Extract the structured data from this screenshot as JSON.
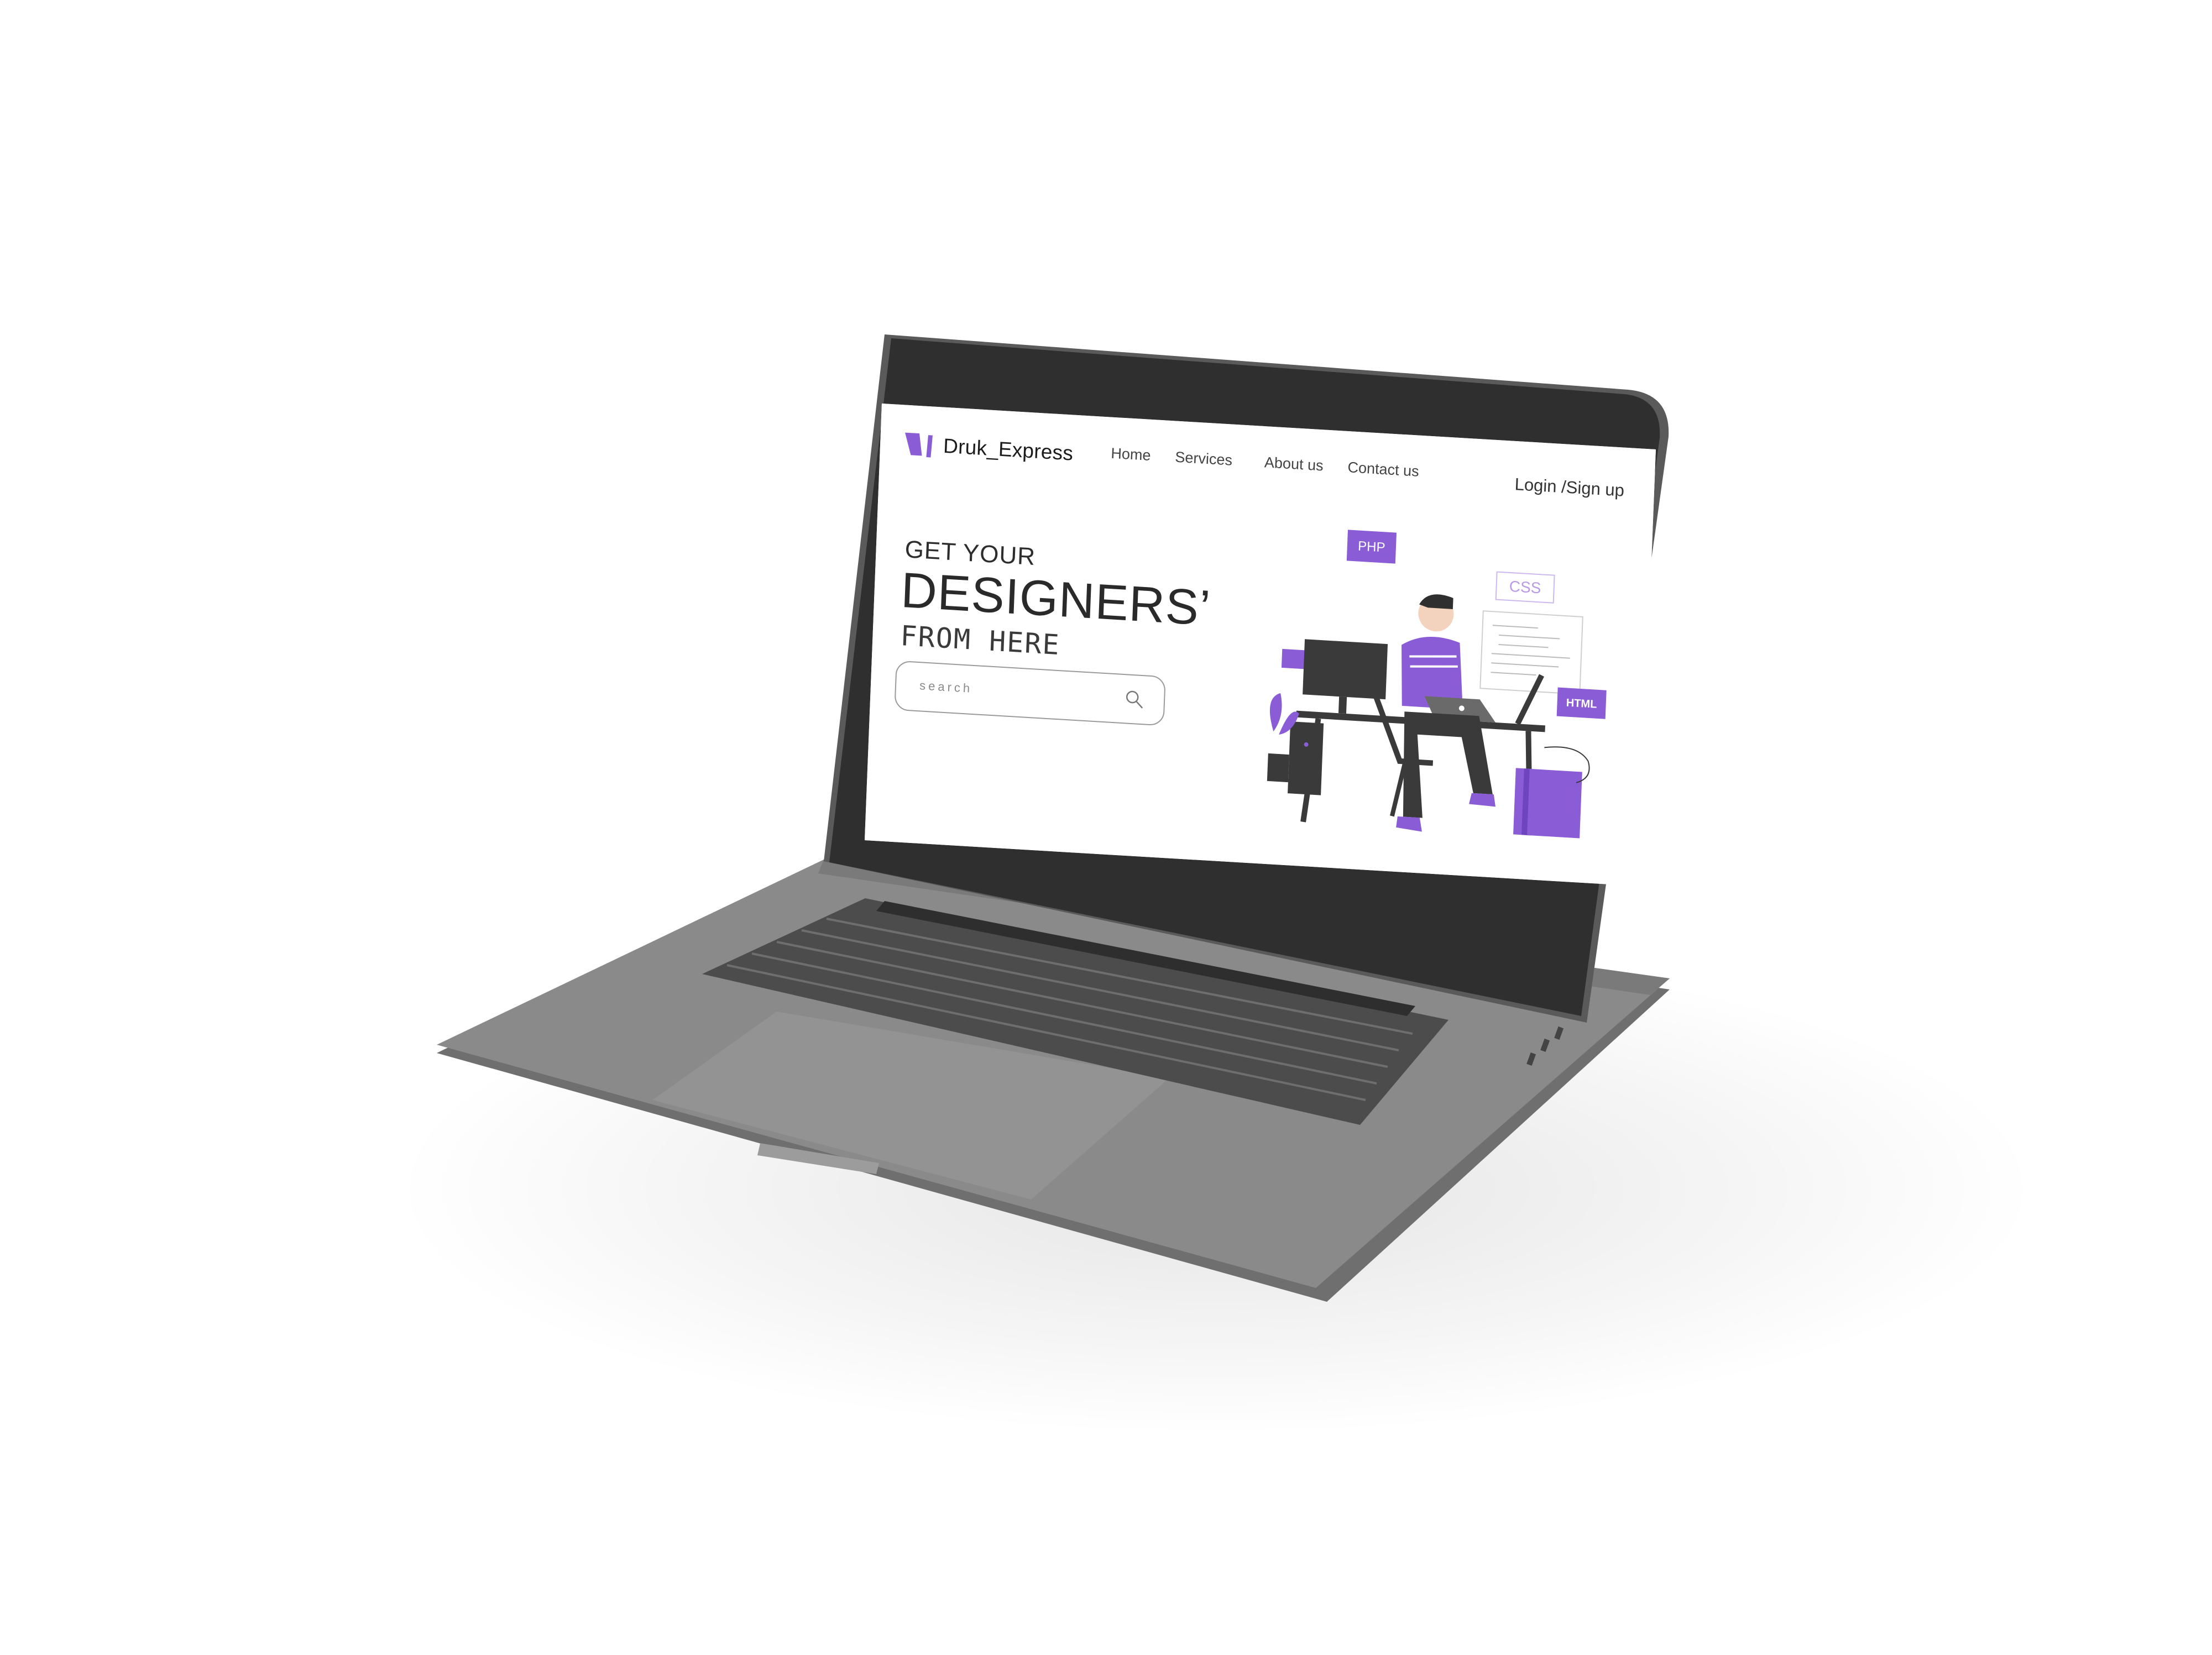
{
  "site": {
    "brand": "Druk_Express",
    "nav": [
      "Home",
      "Services",
      "About us",
      "Contact  us"
    ],
    "auth": "Login /Sign up"
  },
  "hero": {
    "line1": "GET YOUR",
    "line2": "DESIGNERS’",
    "line3": "FROM HERE"
  },
  "search": {
    "placeholder": "search"
  },
  "illustration": {
    "tags": [
      "PHP",
      "CSS",
      "HTML"
    ]
  },
  "colors": {
    "accent": "#8a5cd6",
    "bezel": "#3a3a3a",
    "body": "#8a8a8a",
    "keys": "#3f3f3f"
  }
}
